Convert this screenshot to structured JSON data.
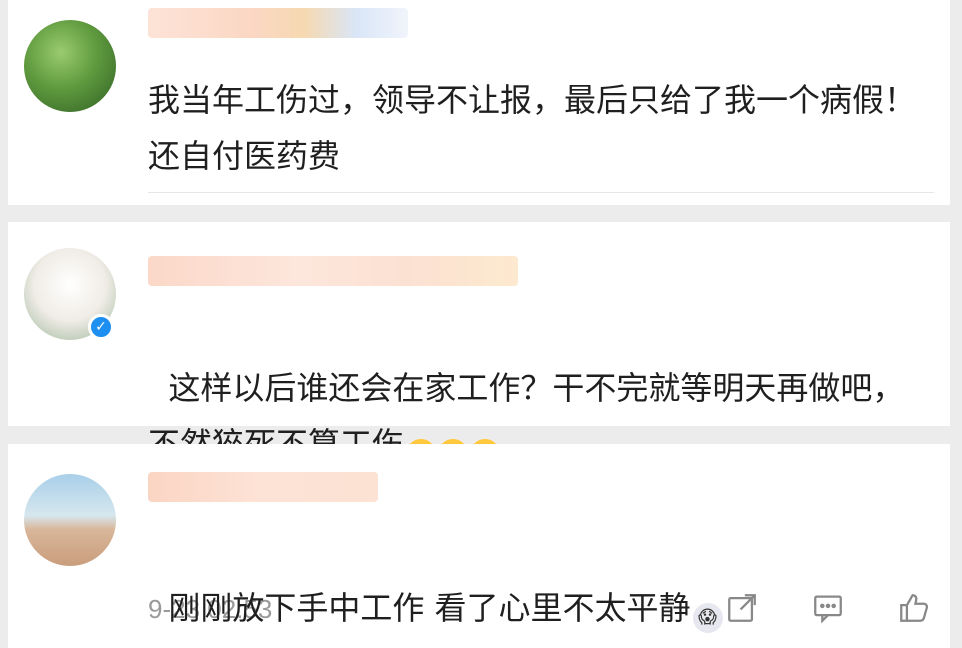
{
  "comments": [
    {
      "username": "",
      "text": "我当年工伤过，领导不让报，最后只给了我一个病假！还自付医药费",
      "verified": false
    },
    {
      "username": "",
      "text": "这样以后谁还会在家工作？干不完就等明天再做吧，不然猝死不算工伤",
      "emoji": [
        "😭",
        "😭",
        "😭"
      ],
      "verified": true
    },
    {
      "username": "",
      "text": "刚刚放下手中工作 看了心里不太平静",
      "emoji": [
        "😱"
      ],
      "timestamp": "9-23 02:53",
      "actions": [
        "share-icon",
        "comment-icon",
        "like-icon"
      ],
      "verified": false
    }
  ],
  "colors": {
    "background": "#ececec",
    "card": "#ffffff",
    "text": "#1f1f1f",
    "timestamp": "#9a9a9a",
    "verified_badge": "#1d8ff0"
  }
}
